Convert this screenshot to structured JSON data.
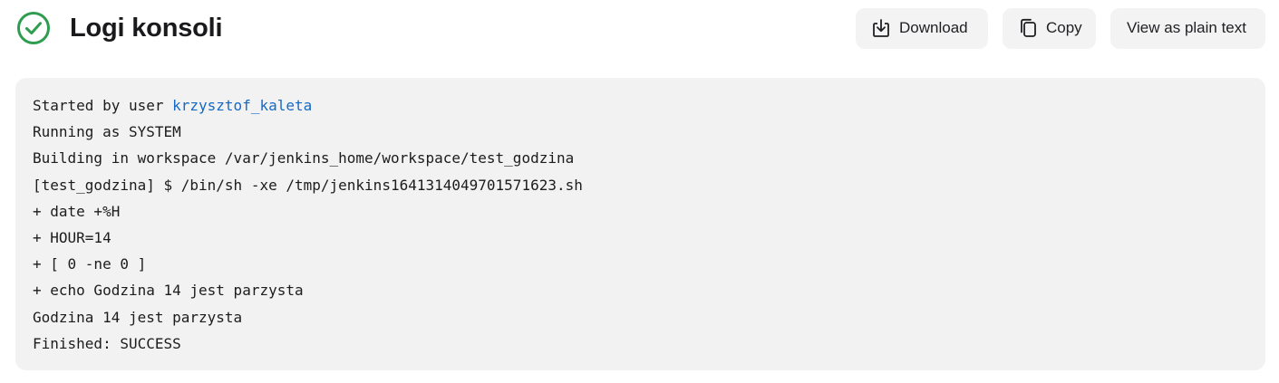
{
  "header": {
    "title": "Logi konsoli",
    "status_icon": "check-circle-icon",
    "status_color": "#2e9d4f"
  },
  "actions": {
    "download_label": "Download",
    "download_icon": "download-icon",
    "copy_label": "Copy",
    "copy_icon": "copy-icon",
    "plain_text_label": "View as plain text"
  },
  "console": {
    "started_prefix": "Started by user ",
    "started_user": "krzysztof_kaleta",
    "link_color": "#1569c7",
    "lines": [
      "Running as SYSTEM",
      "Building in workspace /var/jenkins_home/workspace/test_godzina",
      "[test_godzina] $ /bin/sh -xe /tmp/jenkins1641314049701571623.sh",
      "+ date +%H",
      "+ HOUR=14",
      "+ [ 0 -ne 0 ]",
      "+ echo Godzina 14 jest parzysta",
      "Godzina 14 jest parzysta",
      "Finished: SUCCESS"
    ]
  }
}
